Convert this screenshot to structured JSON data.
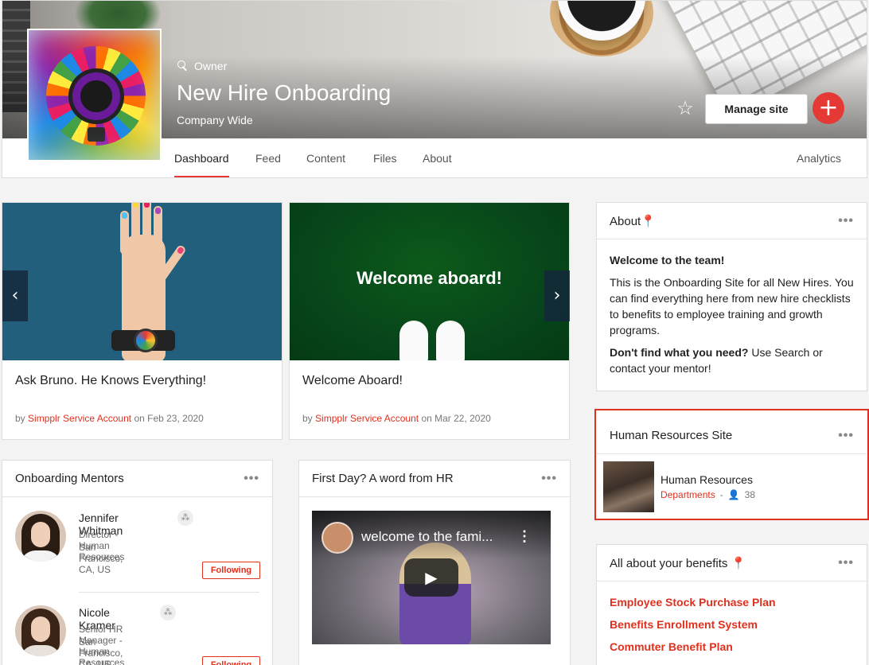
{
  "header": {
    "role": "Owner",
    "title": "New Hire Onboarding",
    "subtitle": "Company Wide",
    "manage_label": "Manage site",
    "add_label": "+",
    "star_label": "☆"
  },
  "tabs": [
    "Dashboard",
    "Feed",
    "Content",
    "Files",
    "About",
    "Analytics"
  ],
  "carousel": [
    {
      "title": "Ask Bruno. He Knows Everything!",
      "by": "by",
      "author": "Simpplr Service Account",
      "on": "on Feb 23, 2020"
    },
    {
      "title": "Welcome Aboard!",
      "image_text": "Welcome aboard!",
      "by": "by",
      "author": "Simpplr Service Account",
      "on": "on Mar 22, 2020"
    }
  ],
  "carousel_nav": {
    "prev": "‹",
    "next": "›"
  },
  "mentors": {
    "title": "Onboarding Mentors",
    "menu": "•••",
    "people": [
      {
        "name": "Jennifer Whitman",
        "role": "Director - Human Resources",
        "location": "San Francisco, CA, US",
        "follow": "Following"
      },
      {
        "name": "Nicole Kramer",
        "role": "Senior HR Manager - Human Resources",
        "location": "San Francisco, CA, US",
        "follow": "Following"
      }
    ]
  },
  "first_day": {
    "title": "First Day? A word from HR",
    "menu": "•••",
    "video_title": "welcome to the fami...",
    "video_menu": "⋮",
    "play": "▶"
  },
  "about": {
    "title": "About📍",
    "menu": "•••",
    "welcome": "Welcome to the team!",
    "body": "This is the Onboarding Site for all New Hires. You can find everything here from new hire checklists to benefits to employee training and growth programs.",
    "help_bold": "Don't find what you need?",
    "help_rest": " Use Search or contact your mentor!"
  },
  "hr_site": {
    "title": "Human Resources Site",
    "menu": "•••",
    "name": "Human Resources",
    "category": "Departments",
    "separator": "-",
    "members": "38"
  },
  "benefits": {
    "title": "All about your benefits 📍",
    "menu": "•••",
    "links": [
      "Employee Stock Purchase Plan",
      "Benefits Enrollment System",
      "Commuter Benefit Plan"
    ]
  },
  "colors": {
    "accent": "#e0301e",
    "add_button": "#e53935"
  }
}
